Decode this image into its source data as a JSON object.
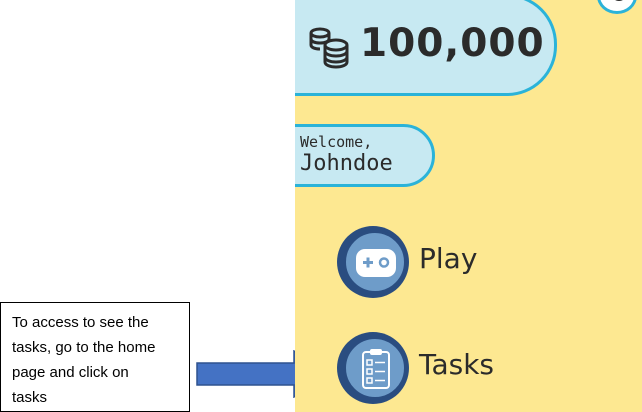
{
  "app": {
    "coins": {
      "icon": "coin-stack-icon",
      "amount": "100,000"
    },
    "welcome": {
      "greeting": "Welcome,",
      "username": "Johndoe"
    },
    "menu": [
      {
        "label": "Play",
        "icon": "gamepad-icon"
      },
      {
        "label": "Tasks",
        "icon": "clipboard-icon"
      }
    ],
    "colors": {
      "background": "#fde891",
      "pill_fill": "#c7e9f2",
      "pill_border": "#2bb3d9",
      "circle_dark": "#2a4d80",
      "circle_light": "#6e9cc9",
      "arrow": "#4472c4"
    }
  },
  "annotation": {
    "lines": [
      "To access to see the",
      "tasks, go to the home",
      "page and click on",
      "tasks"
    ],
    "arrow_icon": "right-arrow-icon"
  }
}
